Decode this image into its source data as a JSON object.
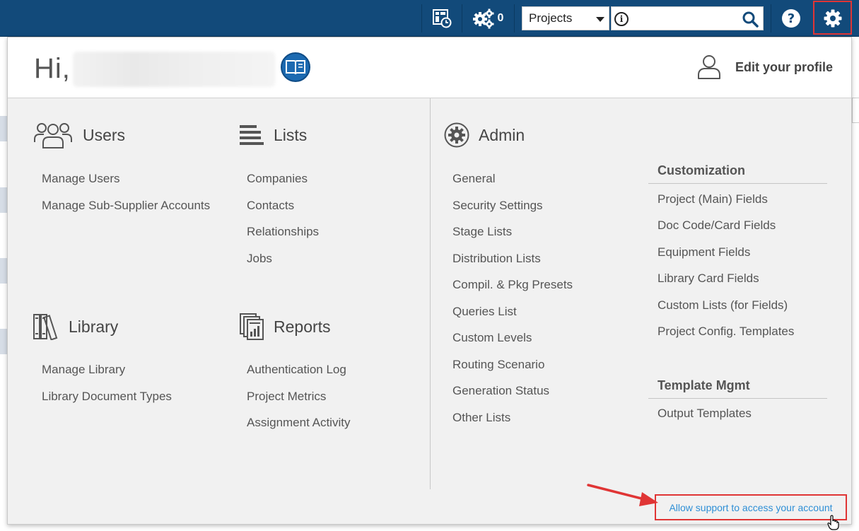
{
  "topbar": {
    "notifications_count": "0",
    "project_selector": {
      "value": "Projects"
    },
    "search": {
      "placeholder": "",
      "value": ""
    },
    "icons": [
      "dashboard-clock-icon",
      "gears-icon",
      "info-icon",
      "search-icon",
      "help-icon",
      "gear-icon"
    ]
  },
  "header": {
    "greeting": "Hi,",
    "edit_profile_label": "Edit your profile"
  },
  "users": {
    "title": "Users",
    "items": [
      "Manage Users",
      "Manage Sub-Supplier Accounts"
    ]
  },
  "lists": {
    "title": "Lists",
    "items": [
      "Companies",
      "Contacts",
      "Relationships",
      "Jobs"
    ]
  },
  "library": {
    "title": "Library",
    "items": [
      "Manage Library",
      "Library Document Types"
    ]
  },
  "reports": {
    "title": "Reports",
    "items": [
      "Authentication Log",
      "Project Metrics",
      "Assignment Activity"
    ]
  },
  "admin": {
    "title": "Admin",
    "items": [
      "General",
      "Security Settings",
      "Stage Lists",
      "Distribution Lists",
      "Compil. & Pkg Presets",
      "Queries List",
      "Custom Levels",
      "Routing Scenario",
      "Generation Status",
      "Other Lists"
    ]
  },
  "customization": {
    "title": "Customization",
    "items": [
      "Project (Main) Fields",
      "Doc Code/Card Fields",
      "Equipment Fields",
      "Library Card Fields",
      "Custom Lists (for Fields)",
      "Project Config. Templates"
    ]
  },
  "template_mgmt": {
    "title": "Template Mgmt",
    "items": [
      "Output Templates"
    ]
  },
  "footer": {
    "support_link": "Allow support to access your account"
  },
  "colors": {
    "topbar": "#124a7a",
    "highlight": "#e03535",
    "link_blue": "#2e8fd6",
    "panel_bg": "#f1f1f1"
  }
}
